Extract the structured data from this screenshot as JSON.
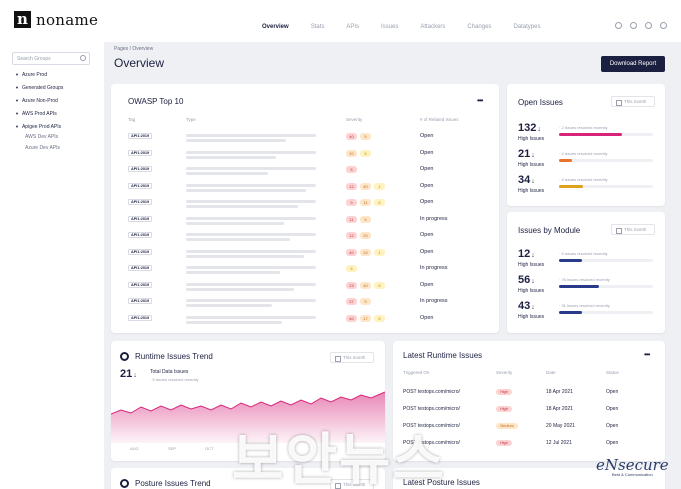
{
  "brand": {
    "logo_letter": "n",
    "name": "noname"
  },
  "nav": [
    "Overview",
    "Stats",
    "APIs",
    "Issues",
    "Attackers",
    "Changes",
    "Datatypes"
  ],
  "sidebar": {
    "search_placeholder": "Search Groups",
    "items": [
      "Azure Prod",
      "Generated Groups",
      "Azure Non-Prod",
      "AWS Prod APIs",
      "Apigee Prod APIs"
    ],
    "subitems": [
      "AWS Dev APIs",
      "Azure Dev APIs"
    ]
  },
  "header": {
    "breadcrumb": "Pages / Overview",
    "title": "Overview",
    "download": "Download Report"
  },
  "owasp": {
    "title": "OWASP Top 10",
    "columns": [
      "Tag",
      "Type",
      "Severity",
      "# of Related Issues"
    ],
    "rows": [
      {
        "tag": "API1:2019",
        "sev": [
          "40",
          "5"
        ],
        "status": "Open"
      },
      {
        "tag": "API1:2019",
        "sev": [
          "20",
          "5"
        ],
        "status": "Open"
      },
      {
        "tag": "API1:2019",
        "sev": [
          "5"
        ],
        "status": "Open"
      },
      {
        "tag": "API1:2019",
        "sev": [
          "12",
          "40",
          "1"
        ],
        "status": "Open"
      },
      {
        "tag": "API1:2019",
        "sev": [
          "9",
          "11",
          "6"
        ],
        "status": "Open"
      },
      {
        "tag": "API1:2019",
        "sev": [
          "11",
          "5"
        ],
        "status": "In progress"
      },
      {
        "tag": "API1:2019",
        "sev": [
          "12",
          "20"
        ],
        "status": "Open"
      },
      {
        "tag": "API1:2019",
        "sev": [
          "40",
          "24",
          "1"
        ],
        "status": "Open"
      },
      {
        "tag": "API1:2019",
        "sev": [
          "5"
        ],
        "status": "In progress"
      },
      {
        "tag": "API1:2019",
        "sev": [
          "23",
          "40",
          "6"
        ],
        "status": "Open"
      },
      {
        "tag": "API1:2019",
        "sev": [
          "27",
          "5"
        ],
        "status": "In progress"
      },
      {
        "tag": "API1:2019",
        "sev": [
          "40",
          "17",
          "5"
        ],
        "status": "Open"
      }
    ]
  },
  "open_issues": {
    "title": "Open Issues",
    "period": "This month",
    "items": [
      {
        "count": "132",
        "label": "High Issues",
        "resolved": "· 2 issues resolved recently",
        "fraction": 0.67,
        "color": "#d6247a"
      },
      {
        "count": "21",
        "label": "High Issues",
        "resolved": "· 4 issues resolved recently",
        "fraction": 0.14,
        "color": "#e8732a"
      },
      {
        "count": "34",
        "label": "High Issues",
        "resolved": "· 8 issues resolved recently",
        "fraction": 0.25,
        "color": "#e0a020"
      }
    ]
  },
  "by_module": {
    "title": "Issues by Module",
    "period": "This month",
    "items": [
      {
        "count": "12",
        "label": "High Issues",
        "resolved": "· 5 issues resolved recently",
        "fraction": 0.24,
        "color": "#2a3a8a"
      },
      {
        "count": "56",
        "label": "High Issues",
        "resolved": "· 76 issues resolved recently",
        "fraction": 0.43,
        "color": "#2a3a8a"
      },
      {
        "count": "43",
        "label": "High Issues",
        "resolved": "· 31 issues resolved recently",
        "fraction": 0.24,
        "color": "#2a3a8a"
      }
    ]
  },
  "runtime_trend": {
    "title": "Runtime Issues Trend",
    "period": "This month",
    "count": "21",
    "total_label": "Total Data Issues",
    "resolved": "· 5 issues resolved recently",
    "x_labels": [
      "AUG",
      "SEP",
      "OCT"
    ],
    "color": "#d6247a"
  },
  "latest_runtime": {
    "title": "Latest Runtime Issues",
    "columns": [
      "Triggered On",
      "Severity",
      "Date",
      "Status"
    ],
    "rows": [
      {
        "trigger": "POST testops.com/micro/",
        "sev": "High",
        "date": "18 Apr 2021",
        "status": "Open"
      },
      {
        "trigger": "POST testops.com/micro/",
        "sev": "High",
        "date": "18 Apr 2021",
        "status": "Open"
      },
      {
        "trigger": "POST testops.com/micro/",
        "sev": "Medium",
        "date": "20 May 2021",
        "status": "Open"
      },
      {
        "trigger": "POST testops.com/micro/",
        "sev": "High",
        "date": "12 Jul 2021",
        "status": "Open"
      }
    ]
  },
  "posture_trend": {
    "title": "Posture Issues Trend",
    "period": "This month"
  },
  "latest_posture": {
    "title": "Latest Posture Issues"
  },
  "watermark": {
    "text": "보안뉴스",
    "brand": "eNsecure",
    "brand_sub": "Best & Communication"
  }
}
